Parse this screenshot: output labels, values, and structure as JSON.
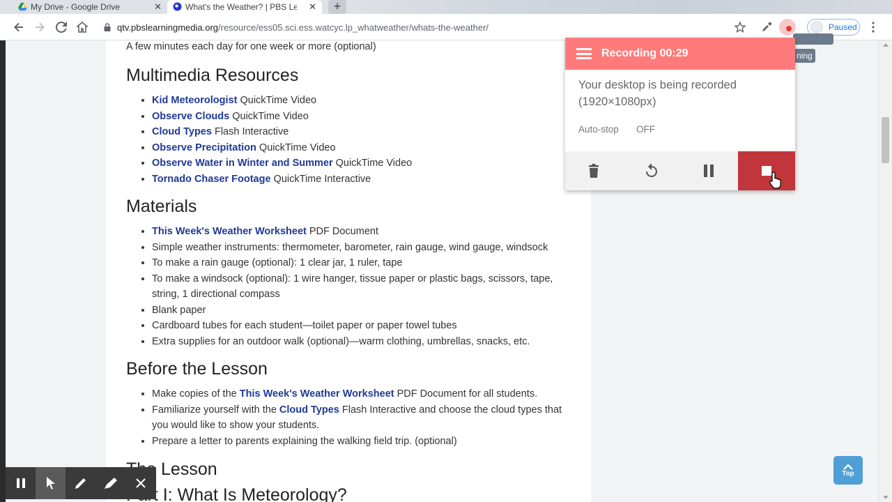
{
  "tabs": [
    {
      "title": "My Drive - Google Drive",
      "active": false
    },
    {
      "title": "What's the Weather? | PBS LearningMedia",
      "active": true
    }
  ],
  "new_tab_label": "+",
  "url": {
    "host": "qtv.pbslearningmedia.org",
    "path": "/resource/ess05.sci.ess.watcyc.lp_whatweather/whats-the-weather/"
  },
  "profile": {
    "label": "Paused"
  },
  "page": {
    "intro": "A few minutes each day for one week or more (optional)",
    "multimedia": {
      "heading": "Multimedia Resources",
      "items": [
        {
          "link": "Kid Meteorologist",
          "rest": " QuickTime Video"
        },
        {
          "link": "Observe Clouds",
          "rest": " QuickTime Video"
        },
        {
          "link": "Cloud Types",
          "rest": " Flash Interactive"
        },
        {
          "link": "Observe Precipitation",
          "rest": " QuickTime Video"
        },
        {
          "link": "Observe Water in Winter and Summer",
          "rest": " QuickTime Video"
        },
        {
          "link": "Tornado Chaser Footage",
          "rest": " QuickTime Interactive"
        }
      ]
    },
    "materials": {
      "heading": "Materials",
      "items": [
        {
          "link": "This Week's Weather Worksheet",
          "rest": " PDF Document"
        },
        {
          "link": "",
          "rest": "Simple weather instruments: thermometer, barometer, rain gauge, wind gauge, windsock"
        },
        {
          "link": "",
          "rest": "To make a rain gauge (optional): 1 clear jar, 1 ruler, tape"
        },
        {
          "link": "",
          "rest": "To make a windsock (optional): 1 wire hanger, tissue paper or plastic bags, scissors, tape, string, 1 directional compass"
        },
        {
          "link": "",
          "rest": "Blank paper"
        },
        {
          "link": "",
          "rest": "Cardboard tubes for each student—toilet paper or paper towel tubes"
        },
        {
          "link": "",
          "rest": "Extra supplies for an outdoor walk (optional)—warm clothing, umbrellas, snacks, etc."
        }
      ]
    },
    "before": {
      "heading": "Before the Lesson",
      "items": [
        {
          "pre": "Make copies of the ",
          "link": "This Week's Weather Worksheet",
          "rest": " PDF Document for all students."
        },
        {
          "pre": "Familiarize yourself with the ",
          "link": "Cloud Types",
          "rest": " Flash Interactive and choose the cloud types that you would like to show your students."
        },
        {
          "pre": "Prepare a letter to parents explaining the walking field trip. (optional)",
          "link": "",
          "rest": ""
        }
      ]
    },
    "lesson_heading": "The Lesson",
    "part_heading": "Part I: What Is Meteorology?",
    "top_button": "Top"
  },
  "recorder": {
    "header": "Recording 00:29",
    "message": "Your desktop is being recorded (1920×1080px)",
    "autostop_label": "Auto-stop",
    "autostop_value": "OFF"
  },
  "hidden_pill_text": "ning",
  "colors": {
    "recorder_header": "#ff7b7b",
    "stop": "#c0363b",
    "link": "#1f3a93",
    "top_button": "#4f9fd6"
  }
}
